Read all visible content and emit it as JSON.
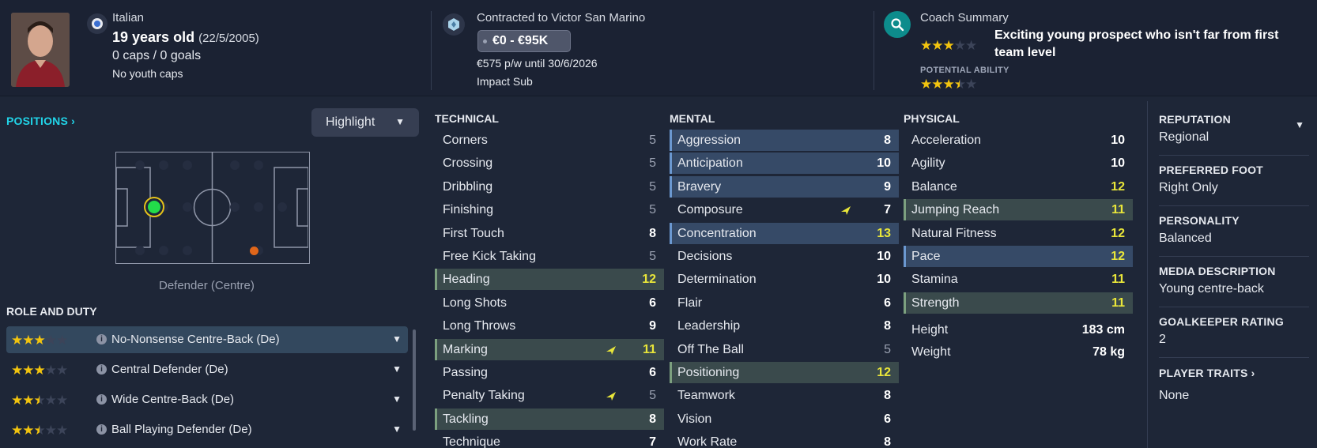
{
  "header": {
    "nationality": "Italian",
    "age": "19 years old",
    "dob": "(22/5/2005)",
    "caps": "0 caps / 0 goals",
    "youth_caps": "No youth caps",
    "contract_to": "Contracted to Victor San Marino",
    "wage_range": "€0 - €95K",
    "wage_detail": "€575 p/w until 30/6/2026",
    "squad_status": "Impact Sub",
    "coach_summary_title": "Coach Summary",
    "coach_summary_text": "Exciting young prospect who isn't far from first team level",
    "current_ability_stars": 3,
    "potential_ability_label": "POTENTIAL ABILITY",
    "potential_ability_stars": 3.5
  },
  "positions": {
    "title": "POSITIONS",
    "highlight_label": "Highlight",
    "position_label": "Defender (Centre)"
  },
  "roles": {
    "title": "ROLE AND DUTY",
    "items": [
      {
        "name": "No-Nonsense Centre-Back (De)",
        "stars": 3,
        "active": true
      },
      {
        "name": "Central Defender (De)",
        "stars": 3,
        "active": false
      },
      {
        "name": "Wide Centre-Back (De)",
        "stars": 2.5,
        "active": false
      },
      {
        "name": "Ball Playing Defender (De)",
        "stars": 2.5,
        "active": false
      }
    ]
  },
  "technical": {
    "title": "TECHNICAL",
    "items": [
      {
        "name": "Corners",
        "value": "5",
        "style": "dim",
        "hl": ""
      },
      {
        "name": "Crossing",
        "value": "5",
        "style": "dim",
        "hl": ""
      },
      {
        "name": "Dribbling",
        "value": "5",
        "style": "dim",
        "hl": ""
      },
      {
        "name": "Finishing",
        "value": "5",
        "style": "dim",
        "hl": ""
      },
      {
        "name": "First Touch",
        "value": "8",
        "style": "",
        "hl": ""
      },
      {
        "name": "Free Kick Taking",
        "value": "5",
        "style": "dim",
        "hl": ""
      },
      {
        "name": "Heading",
        "value": "12",
        "style": "yellow",
        "hl": "green"
      },
      {
        "name": "Long Shots",
        "value": "6",
        "style": "",
        "hl": ""
      },
      {
        "name": "Long Throws",
        "value": "9",
        "style": "",
        "hl": ""
      },
      {
        "name": "Marking",
        "value": "11",
        "style": "yellow",
        "hl": "green",
        "arrow": true
      },
      {
        "name": "Passing",
        "value": "6",
        "style": "",
        "hl": ""
      },
      {
        "name": "Penalty Taking",
        "value": "5",
        "style": "dim",
        "hl": "",
        "arrow": true
      },
      {
        "name": "Tackling",
        "value": "8",
        "style": "",
        "hl": "green"
      },
      {
        "name": "Technique",
        "value": "7",
        "style": "",
        "hl": ""
      }
    ]
  },
  "mental": {
    "title": "MENTAL",
    "items": [
      {
        "name": "Aggression",
        "value": "8",
        "style": "",
        "hl": "blue"
      },
      {
        "name": "Anticipation",
        "value": "10",
        "style": "",
        "hl": "blue"
      },
      {
        "name": "Bravery",
        "value": "9",
        "style": "",
        "hl": "blue"
      },
      {
        "name": "Composure",
        "value": "7",
        "style": "",
        "hl": "",
        "arrow": true
      },
      {
        "name": "Concentration",
        "value": "13",
        "style": "yellow",
        "hl": "blue"
      },
      {
        "name": "Decisions",
        "value": "10",
        "style": "",
        "hl": ""
      },
      {
        "name": "Determination",
        "value": "10",
        "style": "",
        "hl": ""
      },
      {
        "name": "Flair",
        "value": "6",
        "style": "",
        "hl": ""
      },
      {
        "name": "Leadership",
        "value": "8",
        "style": "",
        "hl": ""
      },
      {
        "name": "Off The Ball",
        "value": "5",
        "style": "dim",
        "hl": ""
      },
      {
        "name": "Positioning",
        "value": "12",
        "style": "yellow",
        "hl": "green"
      },
      {
        "name": "Teamwork",
        "value": "8",
        "style": "",
        "hl": ""
      },
      {
        "name": "Vision",
        "value": "6",
        "style": "",
        "hl": ""
      },
      {
        "name": "Work Rate",
        "value": "8",
        "style": "",
        "hl": ""
      }
    ]
  },
  "physical": {
    "title": "PHYSICAL",
    "items": [
      {
        "name": "Acceleration",
        "value": "10",
        "style": "",
        "hl": ""
      },
      {
        "name": "Agility",
        "value": "10",
        "style": "",
        "hl": ""
      },
      {
        "name": "Balance",
        "value": "12",
        "style": "yellow",
        "hl": ""
      },
      {
        "name": "Jumping Reach",
        "value": "11",
        "style": "yellow",
        "hl": "green"
      },
      {
        "name": "Natural Fitness",
        "value": "12",
        "style": "yellow",
        "hl": ""
      },
      {
        "name": "Pace",
        "value": "12",
        "style": "yellow",
        "hl": "blue"
      },
      {
        "name": "Stamina",
        "value": "11",
        "style": "yellow",
        "hl": ""
      },
      {
        "name": "Strength",
        "value": "11",
        "style": "yellow",
        "hl": "green"
      }
    ],
    "height_label": "Height",
    "height_value": "183 cm",
    "weight_label": "Weight",
    "weight_value": "78 kg"
  },
  "info": {
    "reputation_label": "REPUTATION",
    "reputation_value": "Regional",
    "foot_label": "PREFERRED FOOT",
    "foot_value": "Right Only",
    "personality_label": "PERSONALITY",
    "personality_value": "Balanced",
    "media_label": "MEDIA DESCRIPTION",
    "media_value": "Young centre-back",
    "gk_label": "GOALKEEPER RATING",
    "gk_value": "2",
    "traits_label": "PLAYER TRAITS",
    "traits_value": "None"
  },
  "colors": {
    "background": "#1e2637",
    "accent_cyan": "#21d4e8",
    "star_gold": "#f2c40f",
    "attr_yellow": "#e9e63a",
    "highlight_green": "#3a4a4c",
    "highlight_blue": "#364a67"
  }
}
